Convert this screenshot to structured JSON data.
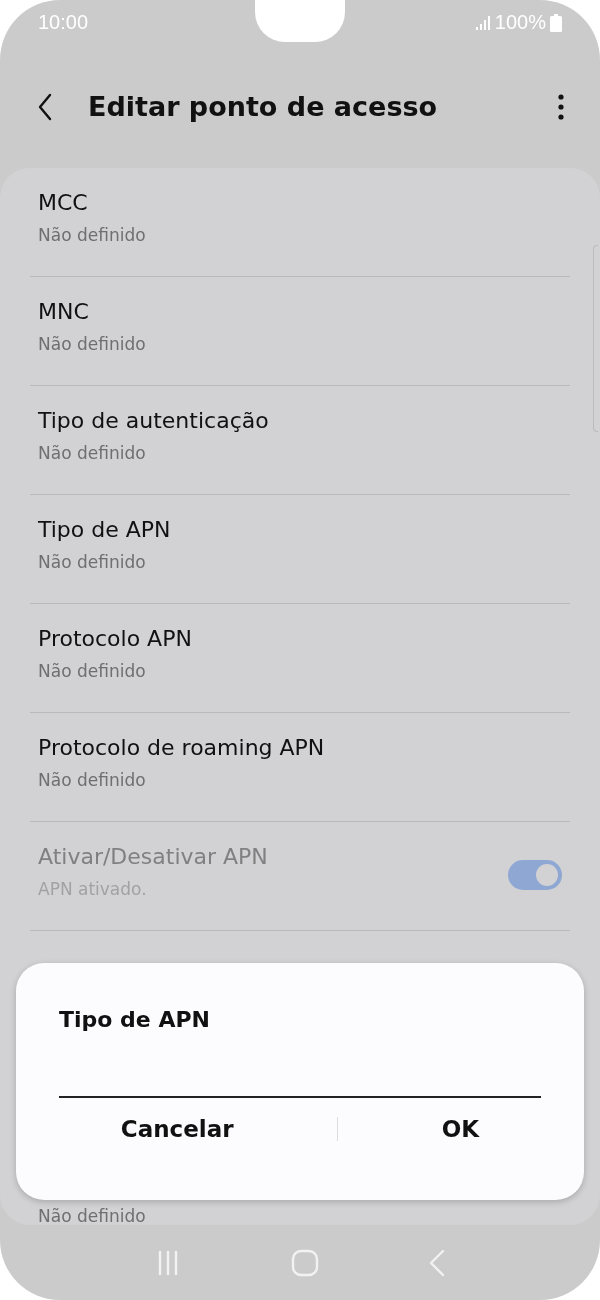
{
  "status_bar": {
    "time": "10:00",
    "battery": "100%"
  },
  "header": {
    "title": "Editar ponto de acesso"
  },
  "items": [
    {
      "title": "MCC",
      "subtitle": "Não definido",
      "enabled": true
    },
    {
      "title": "MNC",
      "subtitle": "Não definido",
      "enabled": true
    },
    {
      "title": "Tipo de autenticação",
      "subtitle": "Não definido",
      "enabled": true
    },
    {
      "title": "Tipo de APN",
      "subtitle": "Não definido",
      "enabled": true
    },
    {
      "title": "Protocolo APN",
      "subtitle": "Não definido",
      "enabled": true
    },
    {
      "title": "Protocolo de roaming APN",
      "subtitle": "Não definido",
      "enabled": true
    },
    {
      "title": "Ativar/Desativar APN",
      "subtitle": "APN ativado.",
      "enabled": false,
      "toggle": {
        "on": true
      }
    },
    {
      "subtitle": "Não definido",
      "enabled": true
    }
  ],
  "dialog": {
    "title": "Tipo de APN",
    "buttons": [
      "Cancelar",
      "OK"
    ]
  }
}
